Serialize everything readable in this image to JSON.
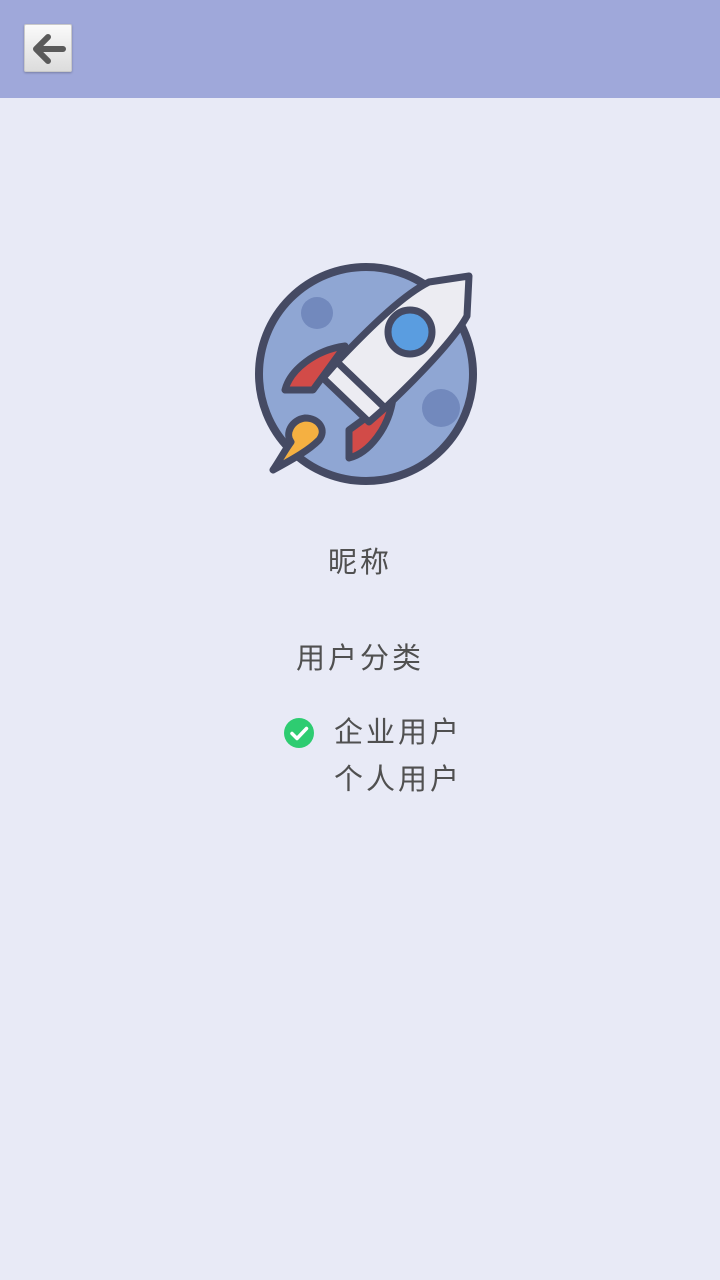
{
  "header": {
    "back_icon": "arrow-left-icon"
  },
  "logo": {
    "icon": "rocket-icon"
  },
  "profile": {
    "nickname_label": "昵称",
    "category_label": "用户分类"
  },
  "user_types": [
    {
      "label": "企业用户",
      "selected": true
    },
    {
      "label": "个人用户",
      "selected": false
    }
  ],
  "colors": {
    "header_bg": "#9fa8da",
    "page_bg": "#e8eaf6",
    "check_green": "#2ecc71",
    "text": "#505050"
  }
}
